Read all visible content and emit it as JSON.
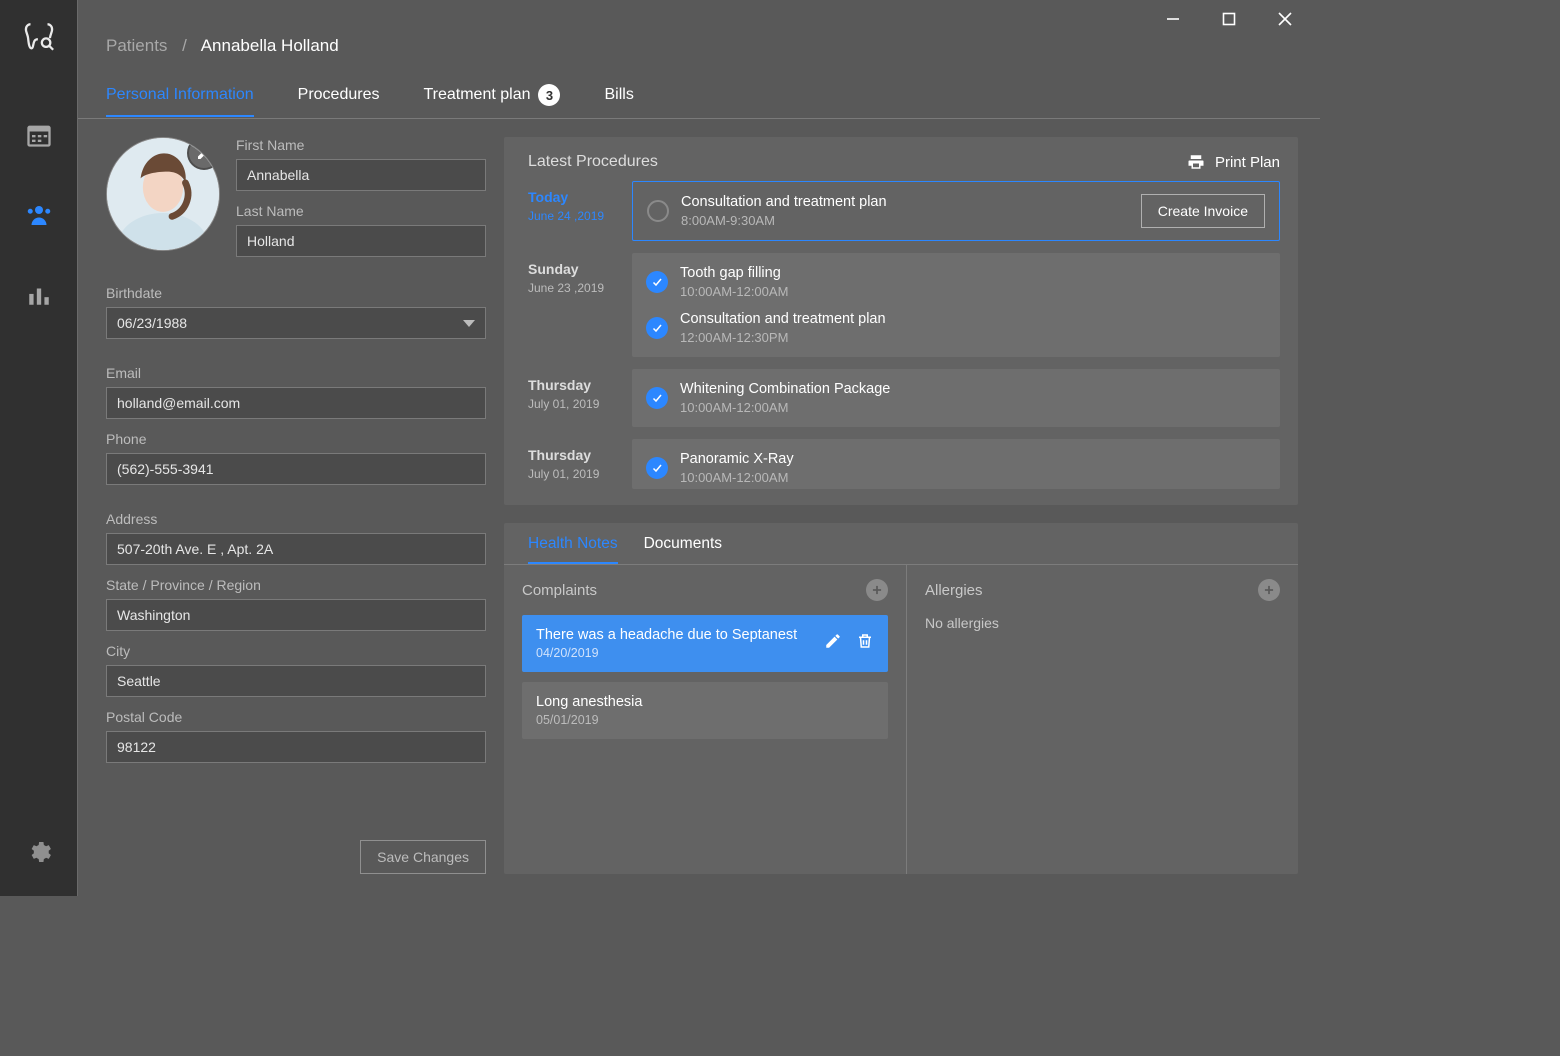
{
  "breadcrumb": {
    "parent": "Patients",
    "current": "Annabella Holland"
  },
  "tabs": {
    "personal": "Personal  Information",
    "procedures": "Procedures",
    "treatment": "Treatment plan",
    "treatment_badge": "3",
    "bills": "Bills"
  },
  "form": {
    "first_name_label": "First Name",
    "first_name": "Annabella",
    "last_name_label": "Last Name",
    "last_name": "Holland",
    "birthdate_label": "Birthdate",
    "birthdate": "06/23/1988",
    "email_label": "Email",
    "email": "holland@email.com",
    "phone_label": "Phone",
    "phone": "(562)-555-3941",
    "address_label": "Address",
    "address": "507-20th Ave. E , Apt. 2A",
    "region_label": "State / Province / Region",
    "region": "Washington",
    "city_label": "City",
    "city": "Seattle",
    "postal_label": "Postal Code",
    "postal": "98122",
    "save_label": "Save Changes"
  },
  "panel": {
    "latest_title": "Latest Procedures",
    "print_label": "Print Plan",
    "create_invoice_label": "Create Invoice"
  },
  "proc_dates": {
    "d0a": "Today",
    "d0b": "June 24 ,2019",
    "d1a": "Sunday",
    "d1b": "June 23 ,2019",
    "d2a": "Thursday",
    "d2b": "July 01, 2019",
    "d3a": "Thursday",
    "d3b": "July 01, 2019"
  },
  "procs": {
    "p0t": "Consultation and treatment plan",
    "p0s": "8:00AM-9:30AM",
    "p1t": "Tooth gap filling",
    "p1s": "10:00AM-12:00AM",
    "p2t": "Consultation and treatment plan",
    "p2s": "12:00AM-12:30PM",
    "p3t": "Whitening Combination Package",
    "p3s": "10:00AM-12:00AM",
    "p4t": "Panoramic X-Ray",
    "p4s": "10:00AM-12:00AM"
  },
  "notes": {
    "tab_health": "Health Notes",
    "tab_docs": "Documents",
    "complaints_title": "Complaints",
    "allergies_title": "Allergies",
    "no_allergies": "No allergies",
    "c0t": "There was a headache due to Septanest",
    "c0d": "04/20/2019",
    "c1t": "Long anesthesia",
    "c1d": "05/01/2019"
  }
}
